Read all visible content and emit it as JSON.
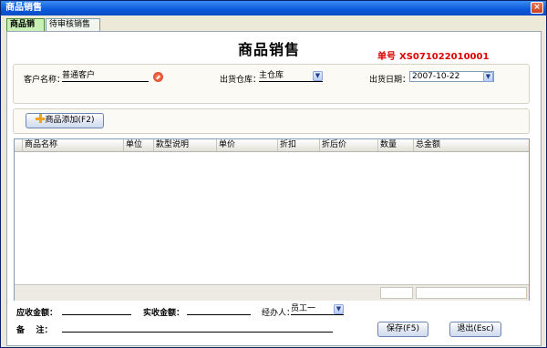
{
  "window": {
    "title": "商品销售",
    "close_glyph": "×"
  },
  "tabs": [
    {
      "label": "商品销售",
      "active": true
    },
    {
      "label": "待审核销售单",
      "active": false
    }
  ],
  "header": {
    "title": "商品销售",
    "order_label": "单号",
    "order_number": "XS071022010001"
  },
  "form": {
    "customer_label": "客户名称：",
    "customer_value": "普通客户",
    "warehouse_label": "出货仓库：",
    "warehouse_value": "主仓库",
    "date_label": "出货日期：",
    "date_value": "2007-10-22"
  },
  "toolbar": {
    "add_label": "商品添加(F2)"
  },
  "table": {
    "columns": [
      "商品名称",
      "单位",
      "款型说明",
      "单价",
      "折扣",
      "折后价",
      "数量",
      "总金额"
    ],
    "rows": []
  },
  "footer": {
    "receivable_label": "应收金额：",
    "received_label": "实收金额：",
    "handler_label": "经办人：",
    "handler_value": "员工一",
    "remark_label": "备    注：",
    "save_label": "保存(F5)",
    "exit_label": "退出(Esc)"
  },
  "colors": {
    "title_bar": "#0a58d8",
    "order_number": "#dd0000",
    "active_tab": "#c8f0b4"
  },
  "icons": [
    "close-icon",
    "search-icon",
    "add-icon",
    "chevron-down-icon"
  ]
}
